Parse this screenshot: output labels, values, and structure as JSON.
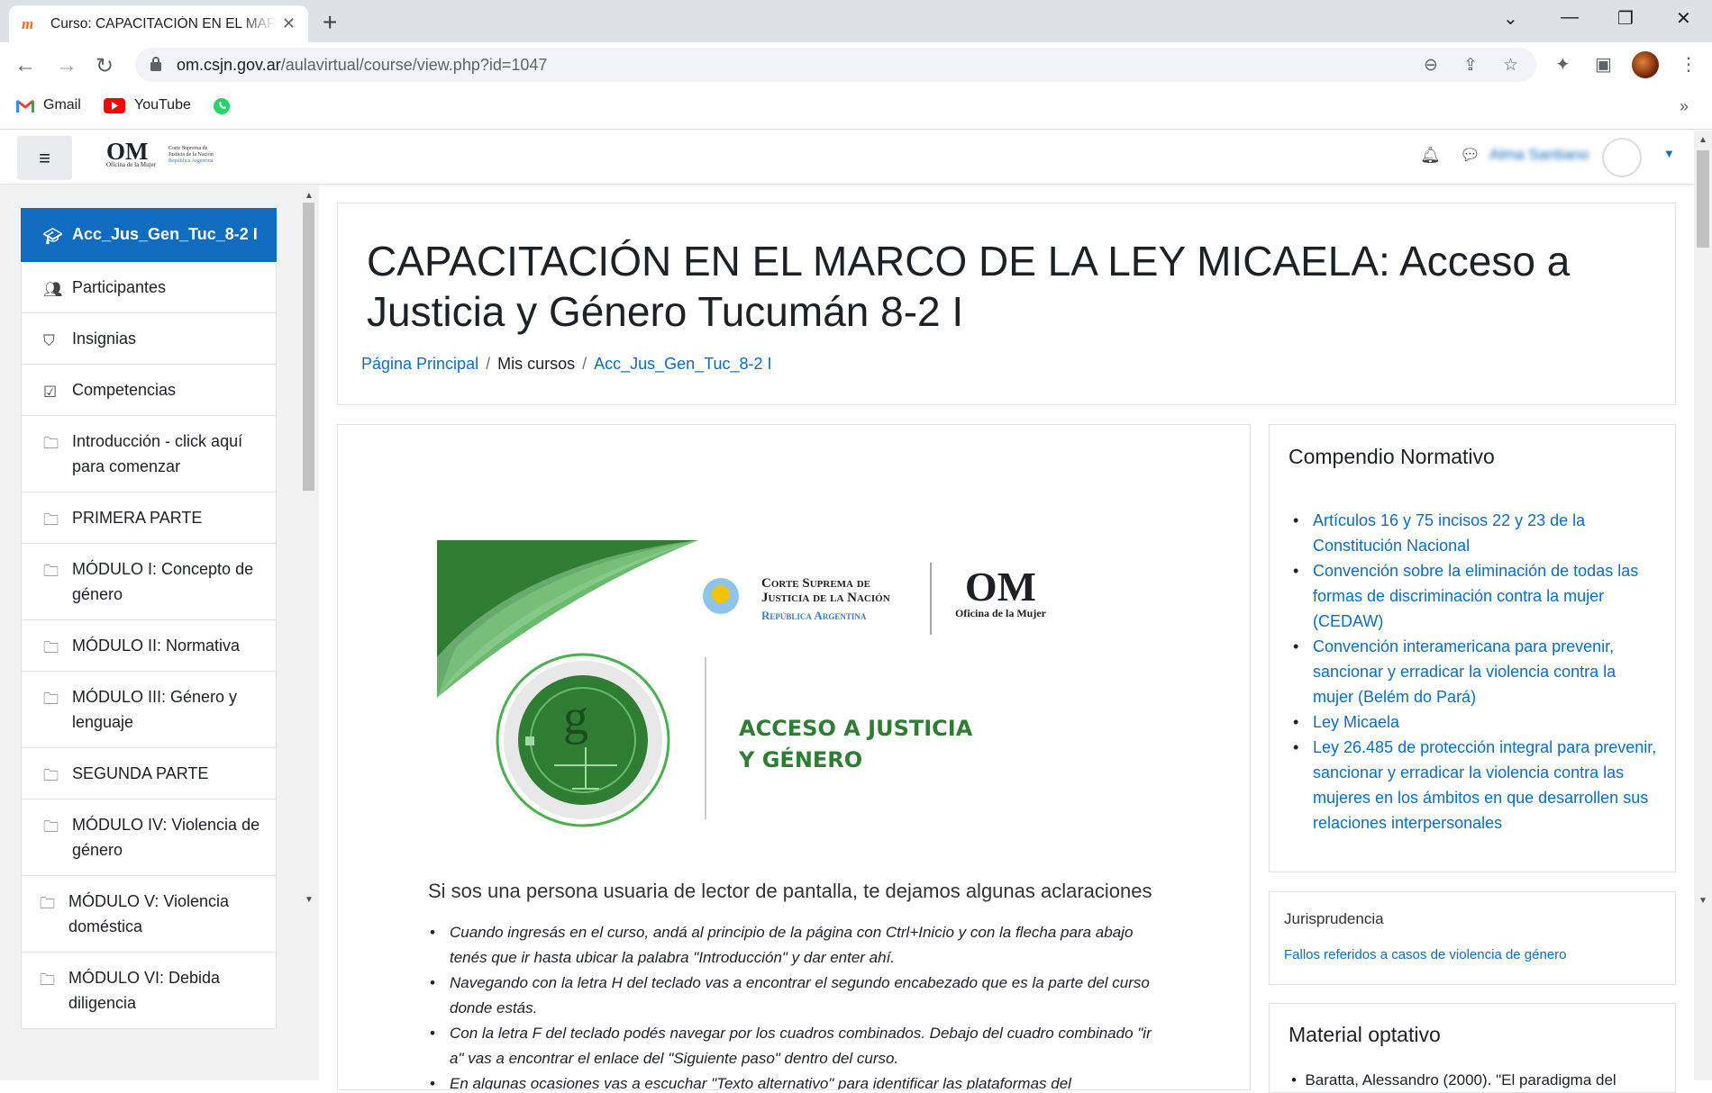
{
  "browser": {
    "tab_title": "Curso: CAPACITACIÓN EN EL MARCO DE LA LEY MICAELA",
    "url_host": "om.csjn.gov.ar",
    "url_path": "/aulavirtual/course/view.php?id=1047",
    "bookmarks": [
      {
        "label": "Gmail",
        "icon": "gmail-icon"
      },
      {
        "label": "YouTube",
        "icon": "youtube-icon"
      },
      {
        "label": "",
        "icon": "whatsapp-icon"
      }
    ]
  },
  "navbar": {
    "logo_text": "OM",
    "logo_sub": "Oficina de la Mujer",
    "csjn_line1": "Corte Suprema de",
    "csjn_line2": "Justicia de la Nación",
    "csjn_line3": "República Argentina",
    "user_name": "Alma Santiano"
  },
  "sidebar": {
    "items": [
      {
        "label": "Acc_Jus_Gen_Tuc_8-2 I",
        "icon": "graduation-cap-icon"
      },
      {
        "label": "Participantes",
        "icon": "users-icon"
      },
      {
        "label": "Insignias",
        "icon": "shield-icon"
      },
      {
        "label": "Competencias",
        "icon": "checkbox-icon"
      },
      {
        "label": "Introducción - click aquí para comenzar",
        "icon": "folder-icon"
      },
      {
        "label": "PRIMERA PARTE",
        "icon": "folder-icon"
      },
      {
        "label": "MÓDULO I: Concepto de género",
        "icon": "folder-icon"
      },
      {
        "label": "MÓDULO II: Normativa",
        "icon": "folder-icon"
      },
      {
        "label": "MÓDULO III: Género y lenguaje",
        "icon": "folder-icon"
      },
      {
        "label": "SEGUNDA PARTE",
        "icon": "folder-icon"
      },
      {
        "label": "MÓDULO IV: Violencia de género",
        "icon": "folder-icon"
      },
      {
        "label": "MÓDULO V: Violencia doméstica",
        "icon": "folder-icon"
      },
      {
        "label": "MÓDULO VI: Debida diligencia",
        "icon": "folder-icon"
      }
    ]
  },
  "header": {
    "title": "CAPACITACIÓN EN EL MARCO DE LA LEY MICAELA: Acceso a Justicia y Género Tucumán 8-2 I",
    "breadcrumb": [
      "Página Principal",
      "Mis cursos",
      "Acc_Jus_Gen_Tuc_8-2 I"
    ]
  },
  "banner": {
    "csjn_line1": "Corte Suprema de",
    "csjn_line2": "Justicia de la Nación",
    "csjn_line3": "República Argentina",
    "om": "OM",
    "om_sub": "Oficina de la Mujer",
    "heading_line1": "ACCESO A JUSTICIA",
    "heading_line2": "Y GÉNERO"
  },
  "main": {
    "readers_title": "Si sos una persona usuaria de lector de pantalla, te dejamos algunas aclaraciones",
    "readers_items": [
      "Cuando ingresás en el curso, andá al principio de la página con Ctrl+Inicio y con la flecha para abajo tenés que ir hasta ubicar la palabra \"Introducción\" y dar enter ahí.",
      "Navegando con la letra H del teclado vas a encontrar el segundo encabezado que es la parte del curso donde estás.",
      "Con la letra F del teclado podés navegar por los cuadros combinados. Debajo del cuadro combinado \"ir a\" vas a encontrar el enlace del \"Siguiente paso\" dentro del curso.",
      "En algunas ocasiones vas a escuchar \"Texto alternativo\" para identificar las plataformas del"
    ]
  },
  "blocks": {
    "compendio": {
      "title": "Compendio Normativo",
      "links": [
        "Artículos 16 y 75 incisos 22 y 23 de la Constitución Nacional",
        "Convención sobre la eliminación de todas las formas de discriminación contra la mujer (CEDAW)",
        "Convención interamericana para prevenir, sancionar y erradicar la violencia contra la mujer (Belém do Pará)",
        "Ley Micaela",
        "Ley 26.485 de protección integral para prevenir, sancionar y erradicar la violencia contra las mujeres en los ámbitos en que desarrollen sus relaciones interpersonales"
      ]
    },
    "jurisprudencia": {
      "title": "Jurisprudencia",
      "link": "Fallos referidos a casos de violencia de género"
    },
    "material": {
      "title": "Material optativo",
      "first_item": "Baratta, Alessandro (2000). \"El paradigma del"
    }
  },
  "colors": {
    "brand_blue": "#0f6cbf",
    "om_green": "#2e7d32"
  }
}
